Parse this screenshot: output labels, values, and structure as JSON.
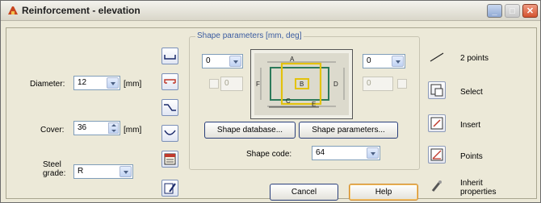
{
  "window": {
    "title": "Reinforcement - elevation"
  },
  "left": {
    "diameter_label": "Diameter:",
    "diameter_value": "12",
    "diameter_unit": "[mm]",
    "cover_label": "Cover:",
    "cover_value": "36",
    "cover_unit": "[mm]",
    "steel_grade_label": "Steel grade:",
    "steel_grade_value": "R"
  },
  "shape": {
    "group_title": "Shape parameters [mm, deg]",
    "left_combo": "0",
    "right_combo": "0",
    "left_field": "0",
    "right_field": "0",
    "preview_labels": [
      "A",
      "B",
      "C",
      "D",
      "E",
      "F"
    ],
    "database_button": "Shape database...",
    "parameters_button": "Shape parameters...",
    "code_label": "Shape code:",
    "code_value": "64"
  },
  "right": {
    "two_points": "2 points",
    "select": "Select",
    "insert": "Insert",
    "points": "Points",
    "inherit": "Inherit properties"
  },
  "footer": {
    "cancel": "Cancel",
    "help": "Help"
  }
}
